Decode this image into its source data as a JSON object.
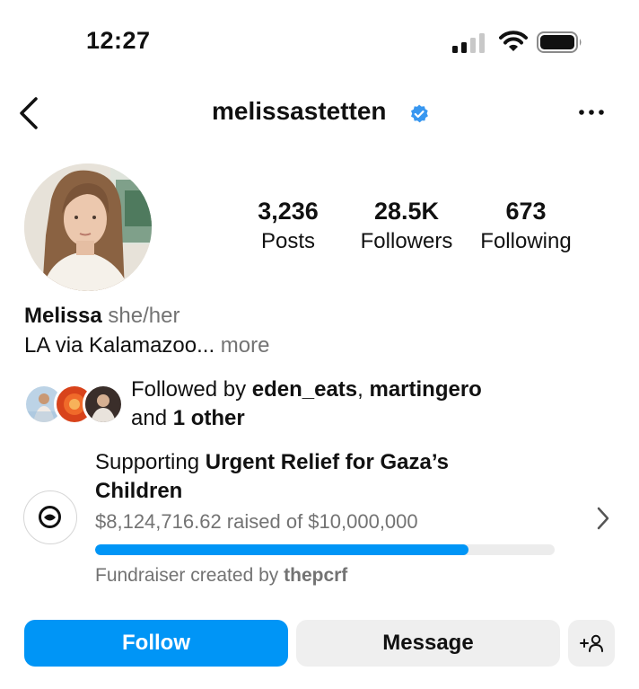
{
  "status_bar": {
    "time": "12:27"
  },
  "header": {
    "username": "melissastetten"
  },
  "stats": [
    {
      "value": "3,236",
      "label": "Posts"
    },
    {
      "value": "28.5K",
      "label": "Followers"
    },
    {
      "value": "673",
      "label": "Following"
    }
  ],
  "profile": {
    "name": "Melissa",
    "pronouns": "she/her",
    "bio": "LA via Kalamazoo...",
    "more": "more"
  },
  "followed_by": {
    "prefix": "Followed by",
    "user1": "eden_eats",
    "separator": ",",
    "user2": "martingero",
    "and_text": "and",
    "others": "1 other"
  },
  "fundraiser": {
    "supporting_text": "Supporting",
    "title_part1": "Urgent Relief for Gaza’s",
    "title_part2": "Children",
    "raised_text": "$8,124,716.62 raised of $10,000,000",
    "progress_fraction": 0.8125,
    "created_by_text": "Fundraiser created by",
    "creator": "thepcrf"
  },
  "buttons": {
    "follow": "Follow",
    "message": "Message"
  },
  "colors": {
    "accent": "#0095f6",
    "verified": "#3897f0",
    "muted": "#737373",
    "secondary_button": "#efefef"
  }
}
